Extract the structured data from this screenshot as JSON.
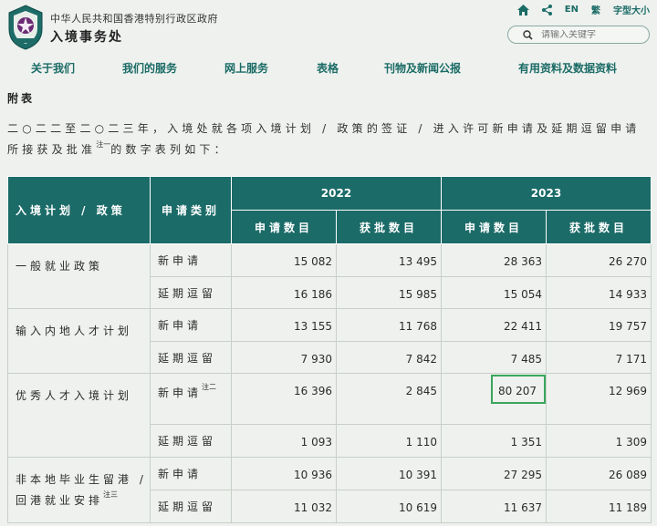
{
  "header": {
    "gov_title": "中华人民共和国香港特别行政区政府",
    "dept_title": "入境事务处",
    "tools": {
      "lang_en": "EN",
      "lang_tc": "繁",
      "font_size": "字型大小"
    },
    "search": {
      "placeholder": "请输入关键字"
    }
  },
  "nav": {
    "items": [
      "关于我们",
      "我们的服务",
      "网上服务",
      "表格",
      "刊物及新闻公报",
      "有用资料及数据资料"
    ]
  },
  "page": {
    "appendix": "附表",
    "intro_before": "二○二二至二○二三年，入境处就各项入境计划 / 政策的签证 / 进入许可新申请及延期逗留申请所接获及批准",
    "intro_note": "注一",
    "intro_after": "的数字表列如下："
  },
  "table": {
    "head": {
      "scheme": "入境计划 / 政策",
      "category": "申请类别",
      "year1": "2022",
      "year2": "2023",
      "received": "申请数目",
      "approved": "获批数目"
    },
    "rows": [
      {
        "scheme": "一般就业政策",
        "note": "",
        "cat1": "新申请",
        "cat1_note": "",
        "cat2": "延期逗留",
        "r1": [
          "15 082",
          "13 495",
          "28 363",
          "26 270"
        ],
        "r2": [
          "16 186",
          "15 985",
          "15 054",
          "14 933"
        ]
      },
      {
        "scheme": "输入内地人才计划",
        "note": "",
        "cat1": "新申请",
        "cat1_note": "",
        "cat2": "延期逗留",
        "r1": [
          "13 155",
          "11 768",
          "22 411",
          "19 757"
        ],
        "r2": [
          "7 930",
          "7 842",
          "7 485",
          "7 171"
        ]
      },
      {
        "scheme": "优秀人才入境计划",
        "note": "",
        "cat1": "新申请",
        "cat1_note": "注二",
        "cat2": "延期逗留",
        "r1": [
          "16 396",
          "2 845",
          "80 207",
          "12 969"
        ],
        "r2": [
          "1 093",
          "1 110",
          "1 351",
          "1 309"
        ]
      },
      {
        "scheme": "非本地毕业生留港 / 回港就业安排",
        "note": "注三",
        "cat1": "新申请",
        "cat1_note": "",
        "cat2": "延期逗留",
        "r1": [
          "10 936",
          "10 391",
          "27 295",
          "26 089"
        ],
        "r2": [
          "11 032",
          "10 619",
          "11 637",
          "11 189"
        ]
      }
    ]
  },
  "colors": {
    "teal": "#1b6b68",
    "highlight": "#3aa65b"
  },
  "icons": [
    "emblem-logo",
    "home-icon",
    "share-icon",
    "search-icon"
  ]
}
